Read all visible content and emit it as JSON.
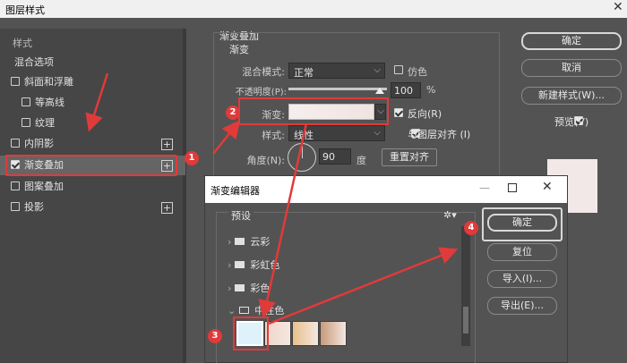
{
  "window": {
    "title": "图层样式",
    "close": "✕"
  },
  "left_panel": {
    "header": "样式",
    "items": [
      {
        "label": "混合选项",
        "checkbox": false,
        "checked": false
      },
      {
        "label": "斜面和浮雕",
        "checkbox": true,
        "checked": false
      },
      {
        "label": "等高线",
        "checkbox": true,
        "checked": false
      },
      {
        "label": "纹理",
        "checkbox": true,
        "checked": false
      },
      {
        "label": "内阴影",
        "checkbox": true,
        "checked": false
      },
      {
        "label": "渐变叠加",
        "checkbox": true,
        "checked": true
      },
      {
        "label": "图案叠加",
        "checkbox": true,
        "checked": false
      },
      {
        "label": "投影",
        "checkbox": true,
        "checked": false
      }
    ]
  },
  "gradient_overlay": {
    "section_title": "渐变叠加",
    "group_title": "渐变",
    "blend_mode_label": "混合模式:",
    "blend_mode_value": "正常",
    "dither_label": "仿色",
    "opacity_label": "不透明度(P):",
    "opacity_value": "100",
    "opacity_unit": "%",
    "gradient_label": "渐变:",
    "reverse_label": "反向(R)",
    "style_label": "样式:",
    "style_value": "线性",
    "align_label": "与图层对齐 (I)",
    "angle_label": "角度(N):",
    "angle_value": "90",
    "angle_unit": "度",
    "reset_align": "重置对齐",
    "opacity_fraction": 1.0
  },
  "right_buttons": {
    "ok": "确定",
    "cancel": "取消",
    "new_style": "新建样式(W)...",
    "preview": "预览(V)"
  },
  "gradient_editor": {
    "title": "渐变编辑器",
    "presets_label": "预设",
    "folders": [
      "云彩",
      "彩虹色",
      "彩色",
      "中性色"
    ],
    "buttons": {
      "ok": "确定",
      "reset": "复位",
      "import": "导入(I)...",
      "export": "导出(E)..."
    },
    "swatch_colors": [
      "#dff1fb",
      "#f0d6c8",
      "#e8c28c",
      "#c79a7a"
    ]
  },
  "annotations": {
    "n1": "1",
    "n2": "2",
    "n3": "3",
    "n4": "4"
  },
  "colors": {
    "accent_red": "#e13a3a"
  }
}
